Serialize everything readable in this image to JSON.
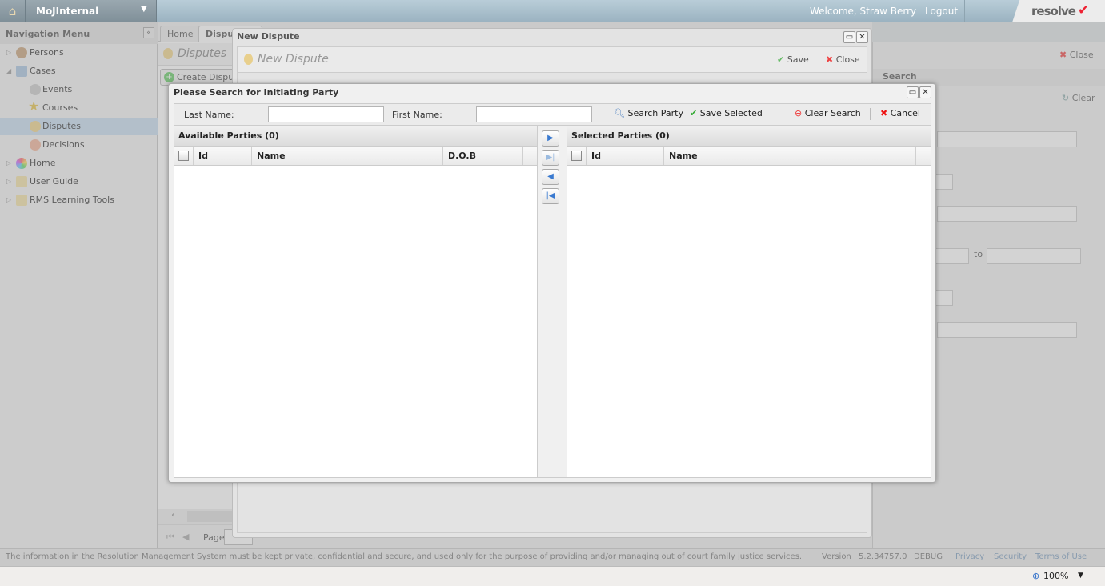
{
  "header": {
    "app_name": "MoJInternal",
    "welcome": "Welcome, Straw Berry",
    "logout": "Logout",
    "logo_text": "resolve"
  },
  "nav": {
    "title": "Navigation Menu",
    "items": [
      {
        "label": "Persons",
        "icon": "persons-icon"
      },
      {
        "label": "Cases",
        "icon": "cases-icon"
      },
      {
        "label": "Events",
        "icon": "medal-icon"
      },
      {
        "label": "Courses",
        "icon": "star-icon"
      },
      {
        "label": "Disputes",
        "icon": "medal-icon",
        "selected": true
      },
      {
        "label": "Decisions",
        "icon": "medal-icon"
      },
      {
        "label": "Home",
        "icon": "globe-icon"
      },
      {
        "label": "User Guide",
        "icon": "folder-icon"
      },
      {
        "label": "RMS Learning Tools",
        "icon": "folder-icon"
      }
    ]
  },
  "tabs": [
    "Home",
    "Disputes"
  ],
  "disputes": {
    "title": "Disputes",
    "create": "Create Dispute",
    "page_label": "Page"
  },
  "right_panel": {
    "close": "Close",
    "search": "Search",
    "clear": "Clear",
    "to": "to"
  },
  "new_dispute": {
    "window_title": "New Dispute",
    "heading": "New Dispute",
    "save": "Save",
    "close": "Close"
  },
  "dialog": {
    "title": "Please Search for Initiating Party",
    "last_name_label": "Last Name:",
    "last_name_value": "",
    "first_name_label": "First Name:",
    "first_name_value": "",
    "search": "Search Party",
    "save_selected": "Save Selected",
    "clear_search": "Clear Search",
    "cancel": "Cancel",
    "available": {
      "title": "Available Parties (0)",
      "columns": [
        "Id",
        "Name",
        "D.O.B"
      ],
      "rows": []
    },
    "selected": {
      "title": "Selected Parties (0)",
      "columns": [
        "Id",
        "Name"
      ],
      "rows": []
    }
  },
  "footer": {
    "notice": "The information in the Resolution Management System must be kept private, confidential and secure, and used only for the purpose of providing and/or managing out of court family justice services.",
    "version_label": "Version",
    "version": "5.2.34757.0",
    "debug": "DEBUG",
    "links": [
      "Privacy",
      "Security",
      "Terms of Use"
    ]
  },
  "statusbar": {
    "zoom": "100%"
  }
}
